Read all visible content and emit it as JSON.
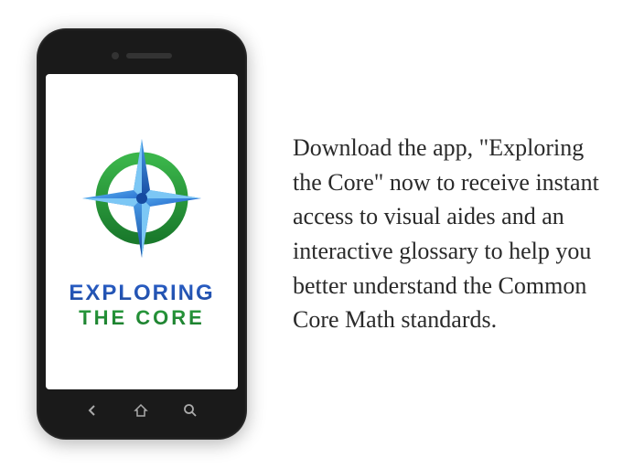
{
  "app": {
    "name_line1": "EXPLORING",
    "name_line2": "THE CORE"
  },
  "description": "Download the app, \"Exploring the Core\" now to receive instant access to visual aides and an interactive glossary to help you better understand the Common Core Math standards.",
  "colors": {
    "compass_blue_light": "#4a9de8",
    "compass_blue_dark": "#1e5fc9",
    "circle_green_light": "#3ab54a",
    "circle_green_dark": "#1a7a2c"
  }
}
